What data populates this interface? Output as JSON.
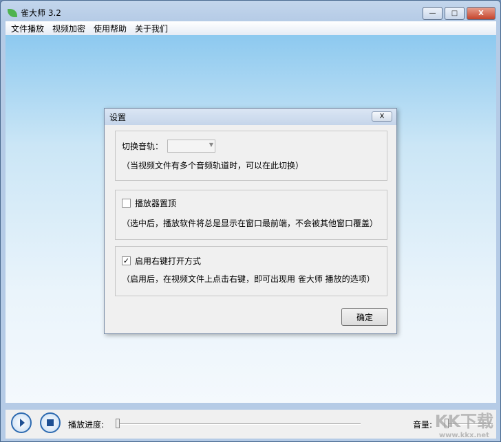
{
  "window": {
    "title": "雀大师 3.2",
    "minimize": "—",
    "maximize": "□",
    "close": "X"
  },
  "menu": [
    "文件播放",
    "视频加密",
    "使用帮助",
    "关于我们"
  ],
  "dialog": {
    "title": "设置",
    "close": "X",
    "audio_track": {
      "label": "切换音轨：",
      "value": "",
      "hint": "（当视频文件有多个音频轨道时，可以在此切换）"
    },
    "always_on_top": {
      "label": "播放器置顶",
      "checked": false,
      "hint": "（选中后，播放软件将总是显示在窗口最前端，不会被其他窗口覆盖）"
    },
    "context_menu": {
      "label": "启用右键打开方式",
      "checked": true,
      "hint": "（启用后，在视频文件上点击右键，即可出现用 雀大师 播放的选项）"
    },
    "ok": "确定"
  },
  "controls": {
    "progress_label": "播放进度:",
    "progress": 0,
    "volume_label": "音量:",
    "volume": 0
  },
  "watermark": {
    "logo": "KK下载",
    "url": "www.kkx.net"
  }
}
